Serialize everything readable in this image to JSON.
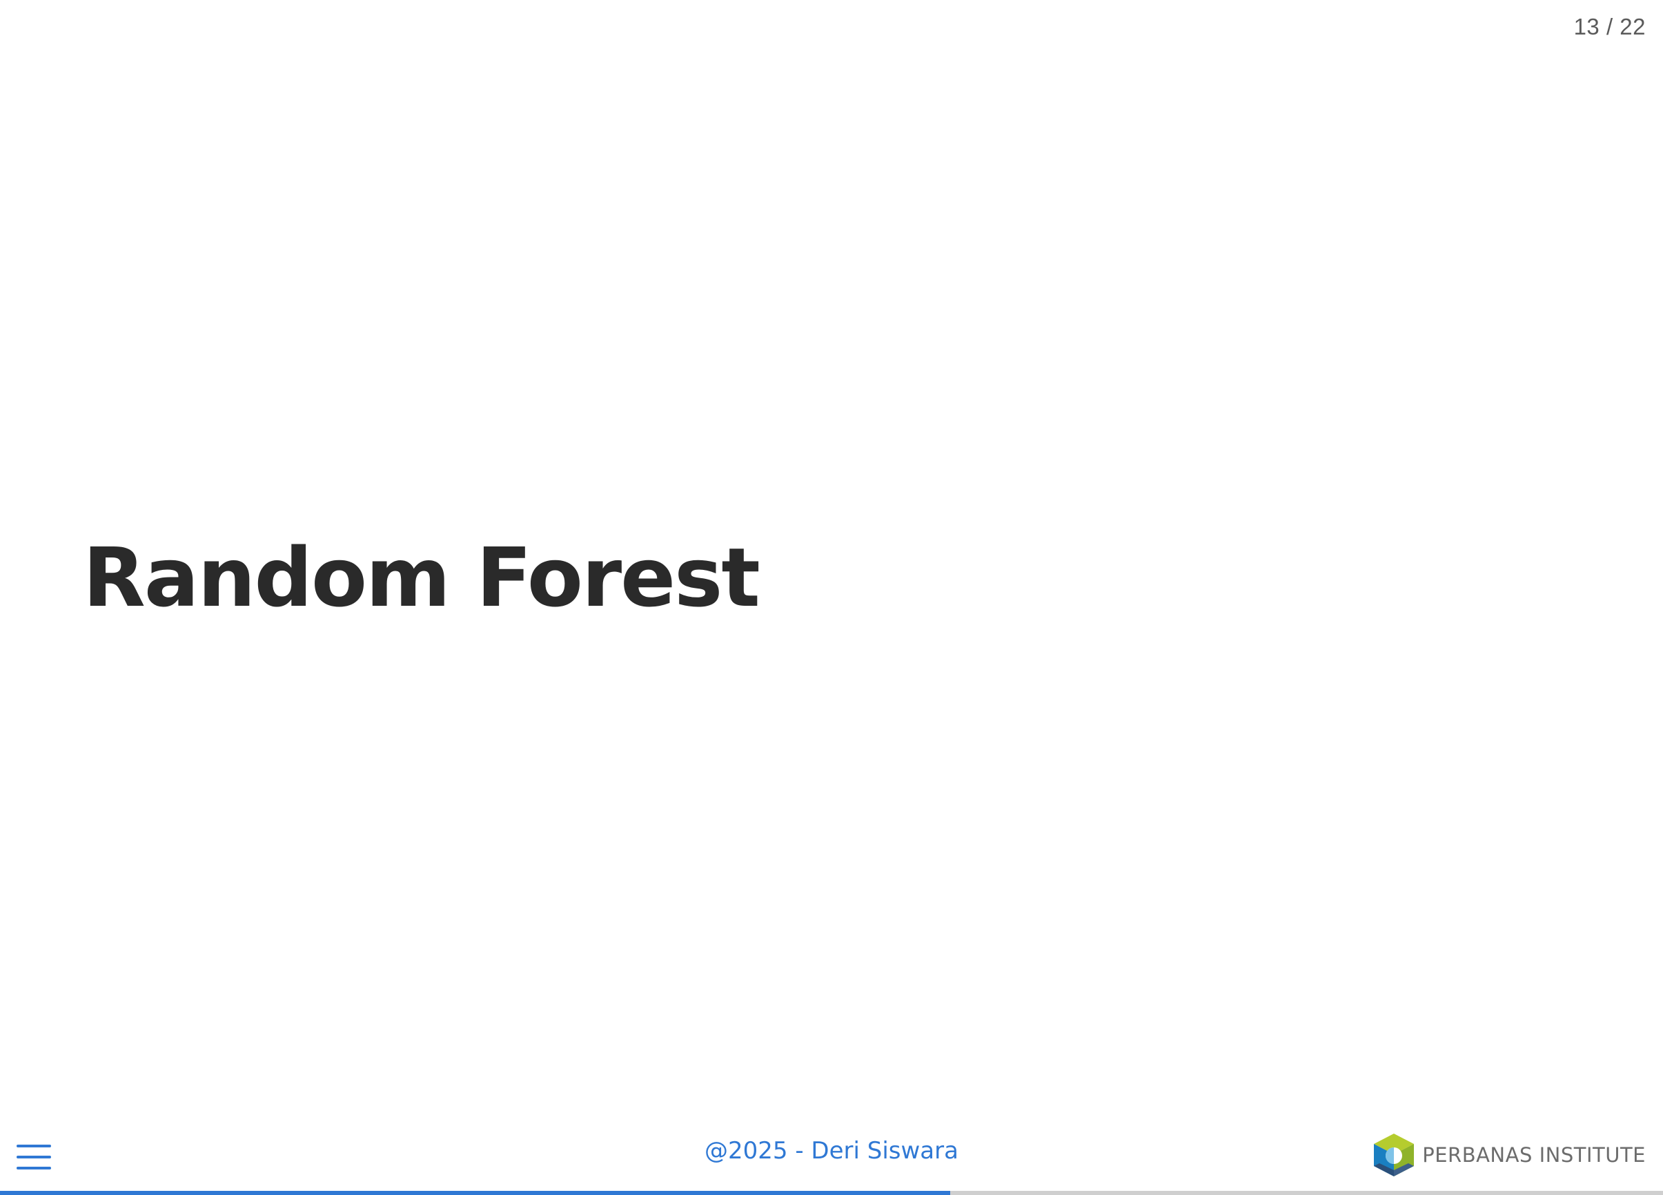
{
  "slide": {
    "title": "Random Forest",
    "counter": "13 / 22",
    "current": 13,
    "total": 22
  },
  "footer": {
    "text": "@2025 - Deri Siswara",
    "logo_text": "PERBANAS INSTITUTE"
  },
  "menu": {
    "icon": "hamburger-menu-icon"
  },
  "progress": {
    "fraction": 0.5714
  },
  "colors": {
    "accent": "#2f78d4",
    "title": "#2a2a2a",
    "counter": "#5a5a5a",
    "progress_track": "#cfcfcf",
    "logo_green": "#b5cc2e",
    "logo_blue": "#1a7fc1",
    "logo_dark": "#2a4f7a"
  }
}
